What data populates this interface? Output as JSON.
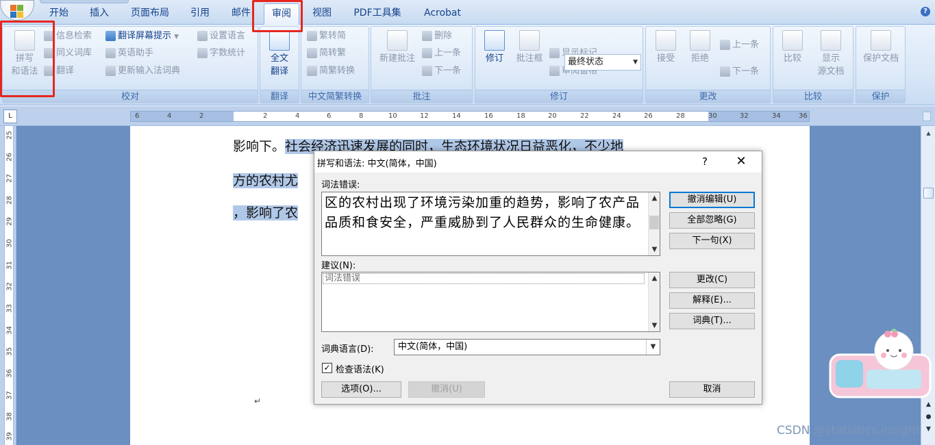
{
  "tabs": [
    "开始",
    "插入",
    "页面布局",
    "引用",
    "邮件",
    "审阅",
    "视图",
    "PDF工具集",
    "Acrobat"
  ],
  "ribbon": {
    "proofing": {
      "label": "校对",
      "spelling_line1": "拼写",
      "spelling_line2": "和语法",
      "research": "信息检索",
      "thesaurus": "同义词库",
      "translate": "翻译",
      "screentip": "翻译屏幕提示",
      "english_assist": "英语助手",
      "update_ime": "更新输入法词典",
      "set_language": "设置语言",
      "word_count": "字数统计"
    },
    "translation": {
      "label": "翻译",
      "full_line1": "全文",
      "full_line2": "翻译"
    },
    "chinese": {
      "label": "中文简繁转换",
      "to_traditional": "繁转简",
      "to_simplified": "简转繁",
      "convert": "简繁转换"
    },
    "comments": {
      "label": "批注",
      "new": "新建批注",
      "delete": "删除",
      "prev": "上一条",
      "next": "下一条"
    },
    "tracking": {
      "label": "修订",
      "track": "修订",
      "balloons": "批注框",
      "state": "最终状态",
      "show_markup": "显示标记",
      "review_pane": "审阅窗格"
    },
    "changes": {
      "label": "更改",
      "accept": "接受",
      "reject": "拒绝",
      "prev": "上一条",
      "next": "下一条"
    },
    "compare": {
      "label": "比较",
      "compare": "比较",
      "source_line1": "显示",
      "source_line2": "源文档"
    },
    "protect": {
      "label": "保护",
      "protect": "保护文档"
    }
  },
  "ruler_ticks": [
    "6",
    "4",
    "2",
    "2",
    "4",
    "6",
    "8",
    "10",
    "12",
    "14",
    "16",
    "18",
    "20",
    "22",
    "24",
    "26",
    "28",
    "30",
    "32",
    "34",
    "36"
  ],
  "vruler_ticks": [
    "25",
    "26",
    "27",
    "28",
    "29",
    "30",
    "31",
    "32",
    "33",
    "34",
    "35",
    "36",
    "37",
    "38",
    "39"
  ],
  "document": {
    "line1_plain": "影响下。",
    "line1_sel": "社会经济迅速发展的同时，生态环境状况日益恶化，不少地",
    "line2_sel": "方的农村尤",
    "line3_sel": "，影响了农"
  },
  "dialog": {
    "title": "拼写和语法: 中文(简体，中国)",
    "help": "?",
    "close": "✕",
    "error_label": "词法错误:",
    "error_text": "区的农村出现了环境污染加重的趋势，影响了农产品品质和食安全，严重威胁到了人民群众的生命健康。",
    "suggestion_label": "建议(N):",
    "suggestion_item": "词法错误",
    "language_label": "词典语言(D):",
    "language_value": "中文(简体，中国)",
    "grammar_check_label": "检查语法(K)",
    "btn_undo_edit": "撤消编辑(U)",
    "btn_ignore_all": "全部忽略(G)",
    "btn_next": "下一句(X)",
    "btn_change": "更改(C)",
    "btn_explain": "解释(E)...",
    "btn_dictionary": "词典(T)...",
    "btn_options": "选项(O)...",
    "btn_undo": "撤消(U)",
    "btn_cancel": "取消"
  },
  "watermark": "CSDN @statistics.insight",
  "colors": {
    "highlight": "#e5261f",
    "selection": "#b0c8e8",
    "accent": "#15428b"
  }
}
